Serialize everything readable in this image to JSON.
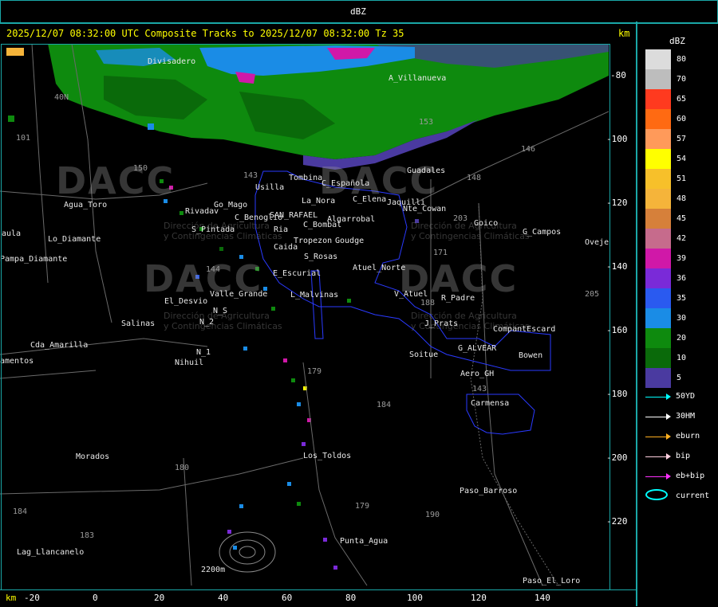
{
  "title_bar": {
    "unit": "dBZ"
  },
  "header": {
    "text": "2025/12/07 08:32:00 UTC Composite Tracks to 2025/12/07 08:32:00 Tz 35",
    "km": "km"
  },
  "axes": {
    "x_unit": "km",
    "x_ticks": [
      "-20",
      "0",
      "20",
      "40",
      "60",
      "80",
      "100",
      "120",
      "140"
    ],
    "y_ticks": [
      "-80",
      "-100",
      "-120",
      "-140",
      "-160",
      "-180",
      "-200",
      "-220"
    ]
  },
  "legend": {
    "title": "dBZ",
    "levels": [
      {
        "label": "80",
        "color": "#dcdcdc"
      },
      {
        "label": "70",
        "color": "#bdbdbd"
      },
      {
        "label": "65",
        "color": "#ff3a1f"
      },
      {
        "label": "60",
        "color": "#ff6a12"
      },
      {
        "label": "57",
        "color": "#ff9a5a"
      },
      {
        "label": "54",
        "color": "#ffff00"
      },
      {
        "label": "51",
        "color": "#f7c02a"
      },
      {
        "label": "48",
        "color": "#f5b43a"
      },
      {
        "label": "45",
        "color": "#d6803a"
      },
      {
        "label": "42",
        "color": "#c66b8c"
      },
      {
        "label": "39",
        "color": "#d018a8"
      },
      {
        "label": "36",
        "color": "#7a2ad8"
      },
      {
        "label": "35",
        "color": "#2a5af0"
      },
      {
        "label": "30",
        "color": "#1a8ce6"
      },
      {
        "label": "20",
        "color": "#0e8a0e"
      },
      {
        "label": "10",
        "color": "#0a6a0a"
      },
      {
        "label": "5",
        "color": "#4a3aa0"
      }
    ],
    "tracks": [
      {
        "label": "50YD",
        "color": "#00ffff"
      },
      {
        "label": "30HM",
        "color": "#ffffff"
      },
      {
        "label": "eburn",
        "color": "#ffb020"
      },
      {
        "label": "bip",
        "color": "#ffd0e0"
      },
      {
        "label": "eb+bip",
        "color": "#ff30ff"
      },
      {
        "label": "current",
        "color": "#00ffff"
      }
    ]
  },
  "watermark": {
    "logo": "DACC",
    "subtitle_1": "Dirección de Agricultura",
    "subtitle_2": "y Contingencias Climáticas"
  },
  "places": [
    {
      "name": "Divisadero"
    },
    {
      "name": "A_Villanueva"
    },
    {
      "name": "Guadales"
    },
    {
      "name": "Tombina"
    },
    {
      "name": "Usilla"
    },
    {
      "name": "C_Española"
    },
    {
      "name": "La_Nora"
    },
    {
      "name": "C_Elena"
    },
    {
      "name": "Jaquilli"
    },
    {
      "name": "Nte_Cowan"
    },
    {
      "name": "Agua_Toro"
    },
    {
      "name": "Go_Mago"
    },
    {
      "name": "Rivadav"
    },
    {
      "name": "C_Benoglio"
    },
    {
      "name": "SAN_RAFAEL"
    },
    {
      "name": "Algarrobal"
    },
    {
      "name": "Goico"
    },
    {
      "name": "G_Campos"
    },
    {
      "name": "Oveje"
    },
    {
      "name": "S_Pintada"
    },
    {
      "name": "C_Bombal"
    },
    {
      "name": "Ria"
    },
    {
      "name": "Tropezon"
    },
    {
      "name": "Goudge"
    },
    {
      "name": "Pampa_Diamante"
    },
    {
      "name": "Lo_Diamante"
    },
    {
      "name": "aula"
    },
    {
      "name": "Caida"
    },
    {
      "name": "S_Rosas"
    },
    {
      "name": "Atuel_Norte"
    },
    {
      "name": "E_Escurial"
    },
    {
      "name": "El_Desvio"
    },
    {
      "name": "Valle_Grande"
    },
    {
      "name": "L_Malvinas"
    },
    {
      "name": "V_Atuel"
    },
    {
      "name": "R_Padre"
    },
    {
      "name": "Salinas"
    },
    {
      "name": "N_S"
    },
    {
      "name": "N_2"
    },
    {
      "name": "J_Prats"
    },
    {
      "name": "CompantEscard"
    },
    {
      "name": "Cda_Amarilla"
    },
    {
      "name": "G_ALVEAR"
    },
    {
      "name": "N_1"
    },
    {
      "name": "Soitue"
    },
    {
      "name": "Bowen"
    },
    {
      "name": "amentos"
    },
    {
      "name": "Nihuil"
    },
    {
      "name": "Aero_GH"
    },
    {
      "name": "Carmensa"
    },
    {
      "name": "Morados"
    },
    {
      "name": "Los_Toldos"
    },
    {
      "name": "Paso_Barroso"
    },
    {
      "name": "Punta_Agua"
    },
    {
      "name": "Lag_Llancanelo"
    },
    {
      "name": "2200m"
    },
    {
      "name": "Paso_El_Loro"
    }
  ],
  "road_numbers": [
    "153",
    "146",
    "148",
    "40N",
    "101",
    "150",
    "143",
    "203",
    "171",
    "144",
    "179",
    "184",
    "180",
    "190",
    "143",
    "179",
    "183",
    "184",
    "205",
    "188"
  ]
}
